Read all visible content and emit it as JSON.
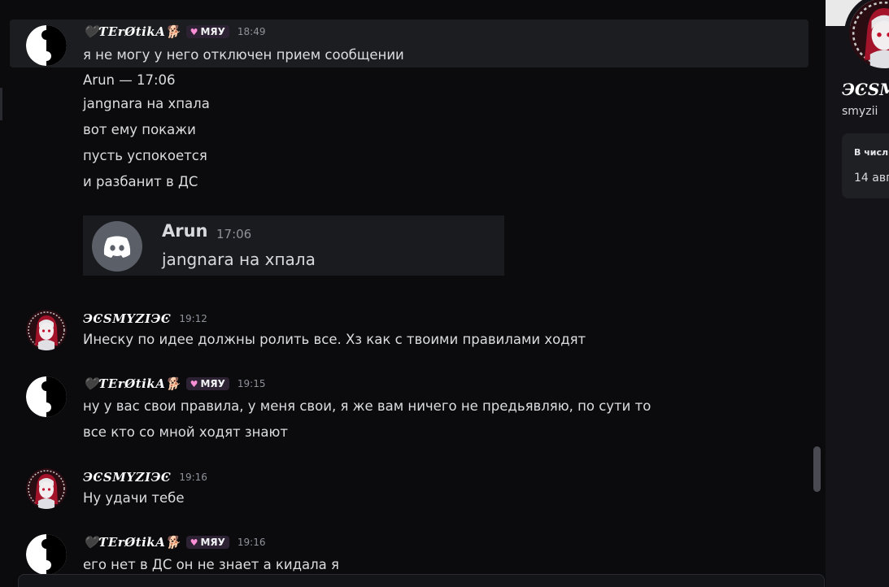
{
  "messages": {
    "first": {
      "username": "🖤ƬErØtikA🐕",
      "badge": "МЯУ",
      "time": "18:49",
      "line": "я не могу у него отключен прием сообщении"
    },
    "plain_lines": [
      "Arun — 17:06",
      "jangnara на хпала",
      "вот ему покажи",
      "пусть успокоется",
      "и разбанит в ДС"
    ],
    "embed": {
      "author": "Arun",
      "time": "17:06",
      "text": "jangnara на хпала"
    },
    "smyzi_1": {
      "username": "ЭϾSMYZIЭϾ",
      "time": "19:12",
      "line": "Инеску по идее должны ролить все. Хз как с твоими правилами ходят"
    },
    "erotika_2": {
      "username": "🖤ƬErØtikA🐕",
      "badge": "МЯУ",
      "time": "19:15",
      "line1": "ну у вас свои правила, у меня свои, я же вам ничего не предьявляю, по сути то",
      "line2": "все кто со мной ходят знают"
    },
    "smyzi_2": {
      "username": "ЭϾSMYZIЭϾ",
      "time": "19:16",
      "line": "Ну удачи тебе"
    },
    "erotika_3": {
      "username": "🖤ƬErØtikA🐕",
      "badge": "МЯУ",
      "time": "19:16",
      "line": "его нет в ДС он не знает а кидала я"
    }
  },
  "profile": {
    "name": "ЭϾSM",
    "username": "smyzii",
    "card_title": "В числ",
    "card_date": "14 авг"
  },
  "colors": {
    "background": "#0b0b0d",
    "highlight": "#1c1d21",
    "text": "#dcdde1",
    "muted": "#8f929a",
    "badge_bg": "#2c2233",
    "heart_badge": "#ff8fd6"
  }
}
